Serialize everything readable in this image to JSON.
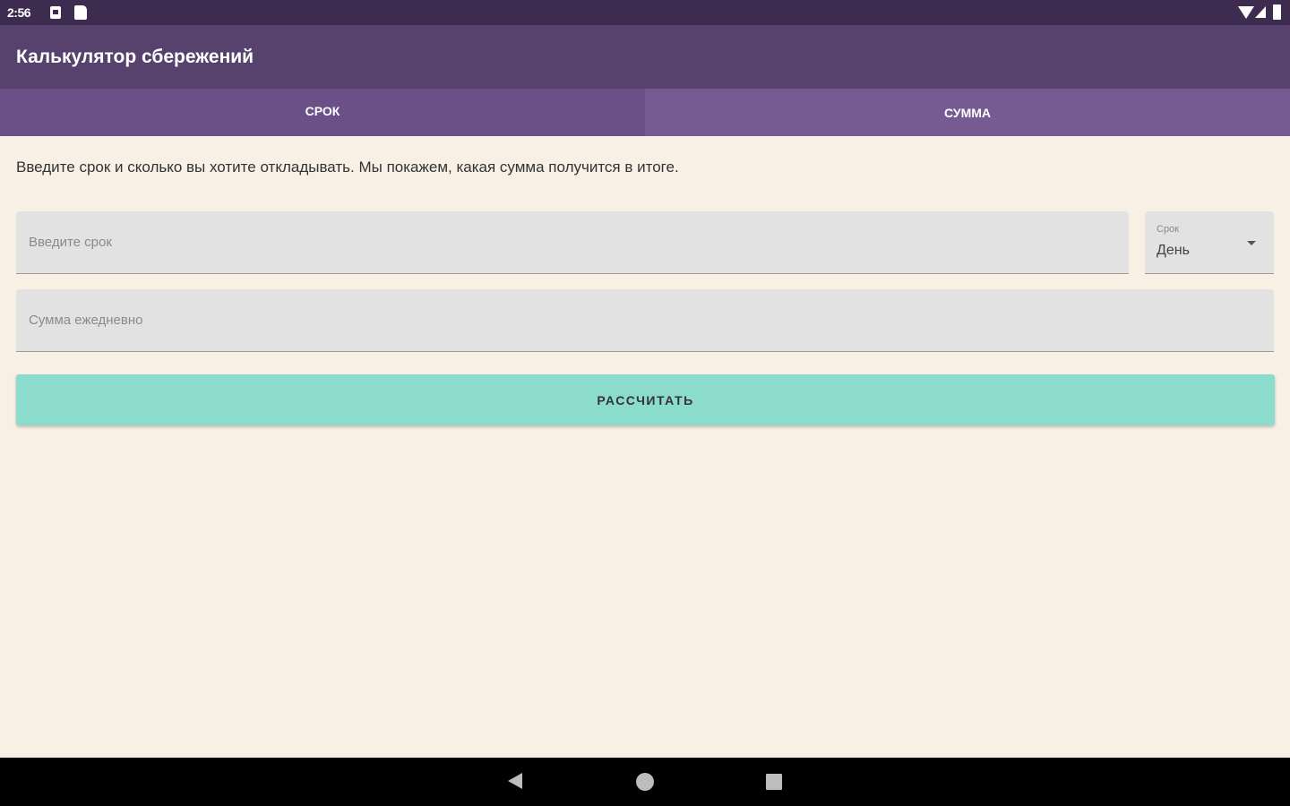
{
  "status_bar": {
    "time": "2:56",
    "icons": [
      "notification-icon",
      "sd-card-icon",
      "wifi-icon",
      "cell-signal-icon",
      "battery-icon"
    ]
  },
  "app_bar": {
    "title": "Калькулятор сбережений"
  },
  "tabs": [
    {
      "label": "СРОК",
      "selected": true
    },
    {
      "label": "СУММА",
      "selected": false
    }
  ],
  "form": {
    "description": "Введите срок и сколько вы хотите откладывать. Мы покажем, какая сумма получится в итоге.",
    "term_placeholder": "Введите срок",
    "period_select": {
      "label": "Срок",
      "value": "День"
    },
    "sum_placeholder": "Сумма ежедневно",
    "calculate_label": "РАССЧИТАТЬ"
  },
  "nav_bar": {
    "icons": [
      "back-icon",
      "home-icon",
      "recents-icon"
    ]
  },
  "colors": {
    "status_bar": "#3e2c50",
    "app_bar": "#57426e",
    "tab_selected": "#6b5088",
    "tab_unselected": "#765b93",
    "background": "#f8f0e4",
    "field": "#e2e2e2",
    "button": "#8cdcce"
  }
}
